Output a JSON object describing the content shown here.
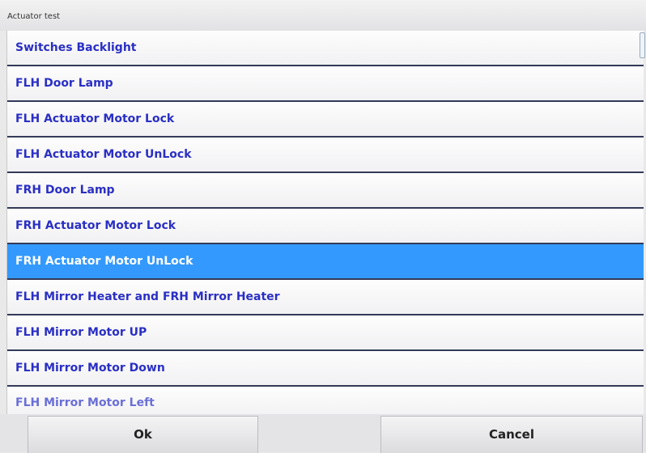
{
  "window": {
    "title": "Actuator test"
  },
  "list": {
    "items": [
      {
        "label": "Switches Backlight",
        "selected": false
      },
      {
        "label": "FLH Door Lamp",
        "selected": false
      },
      {
        "label": "FLH Actuator Motor Lock",
        "selected": false
      },
      {
        "label": "FLH Actuator Motor UnLock",
        "selected": false
      },
      {
        "label": "FRH Door Lamp",
        "selected": false
      },
      {
        "label": "FRH Actuator Motor Lock",
        "selected": false
      },
      {
        "label": "FRH Actuator Motor UnLock",
        "selected": true
      },
      {
        "label": "FLH Mirror Heater and FRH Mirror Heater",
        "selected": false
      },
      {
        "label": "FLH Mirror Motor UP",
        "selected": false
      },
      {
        "label": "FLH Mirror Motor Down",
        "selected": false
      },
      {
        "label": "FLH Mirror Motor Left",
        "selected": false
      }
    ]
  },
  "buttons": {
    "ok_label": "Ok",
    "cancel_label": "Cancel"
  },
  "colors": {
    "selected_bg": "#3399ff",
    "item_text": "#2a2fc4",
    "separator": "#333a58"
  }
}
